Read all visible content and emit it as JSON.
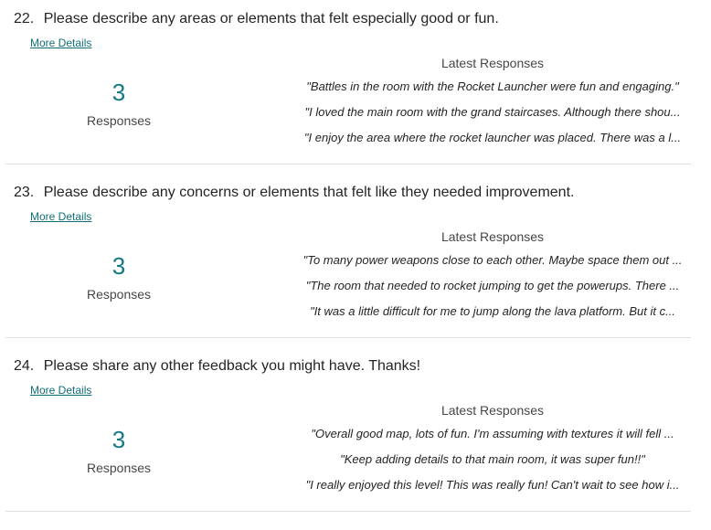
{
  "more_details_label": "More Details",
  "latest_responses_label": "Latest Responses",
  "responses_label": "Responses",
  "questions": [
    {
      "number": "22.",
      "text": "Please describe any areas or elements that felt especially good or fun.",
      "count": "3",
      "responses": [
        "\"Battles in the room with the Rocket Launcher were fun and engaging.\"",
        "\"I loved the main room with the grand staircases. Although there shou...",
        "\"I enjoy the area where the rocket launcher was placed. There was a l..."
      ]
    },
    {
      "number": "23.",
      "text": "Please describe any concerns or elements that felt like they needed improvement.",
      "count": "3",
      "responses": [
        "\"To many power weapons close to each other. Maybe space them out ...",
        "\"The room that needed to rocket jumping to get the powerups. There ...",
        "\"It was a little difficult for me to jump along the lava platform. But it c..."
      ]
    },
    {
      "number": "24.",
      "text": "Please share any other feedback you might have. Thanks!",
      "count": "3",
      "responses": [
        "\"Overall good map, lots of fun. I'm assuming with textures it will fell ...",
        "\"Keep adding details to that main room, it was super fun!!\"",
        "\"I really enjoyed this level! This was really fun! Can't wait to see how i..."
      ]
    }
  ]
}
